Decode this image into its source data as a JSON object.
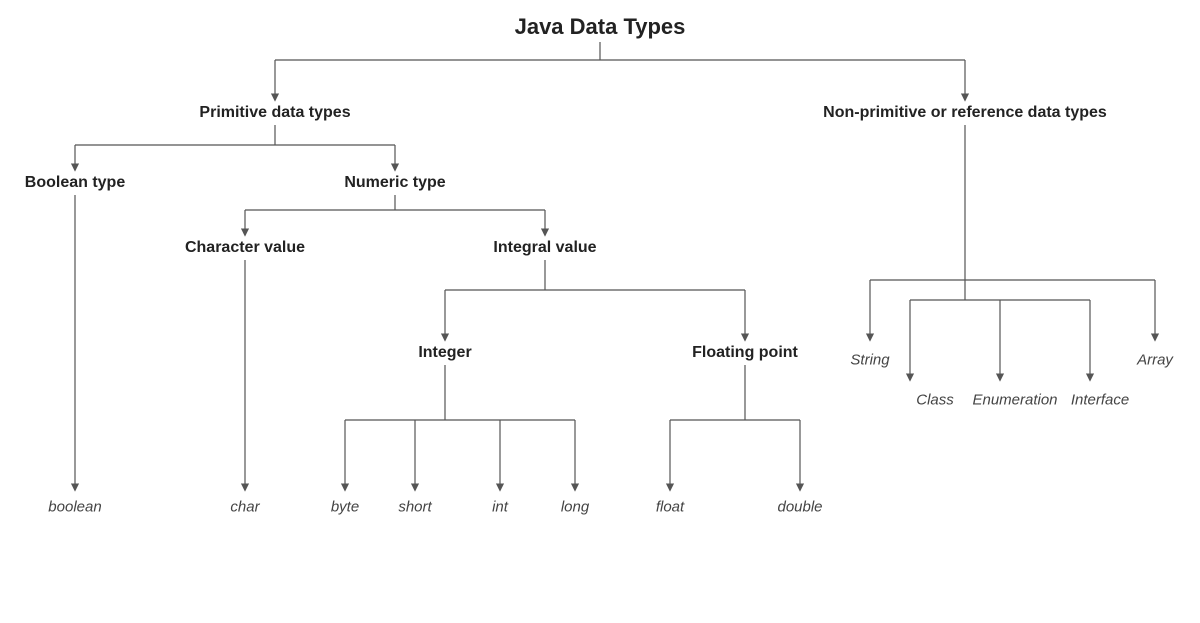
{
  "title": "Java Data Types",
  "primitive": {
    "label": "Primitive data types",
    "boolean_type": "Boolean type",
    "numeric_type": "Numeric type",
    "character_value": "Character value",
    "integral_value": "Integral value",
    "integer": "Integer",
    "floating_point": "Floating point",
    "leaves": {
      "boolean": "boolean",
      "char": "char",
      "byte": "byte",
      "short": "short",
      "int": "int",
      "long": "long",
      "float": "float",
      "double": "double"
    }
  },
  "nonprimitive": {
    "label": "Non-primitive or reference data types",
    "leaves": {
      "string": "String",
      "class": "Class",
      "enumeration": "Enumeration",
      "interface": "Interface",
      "array": "Array"
    }
  }
}
